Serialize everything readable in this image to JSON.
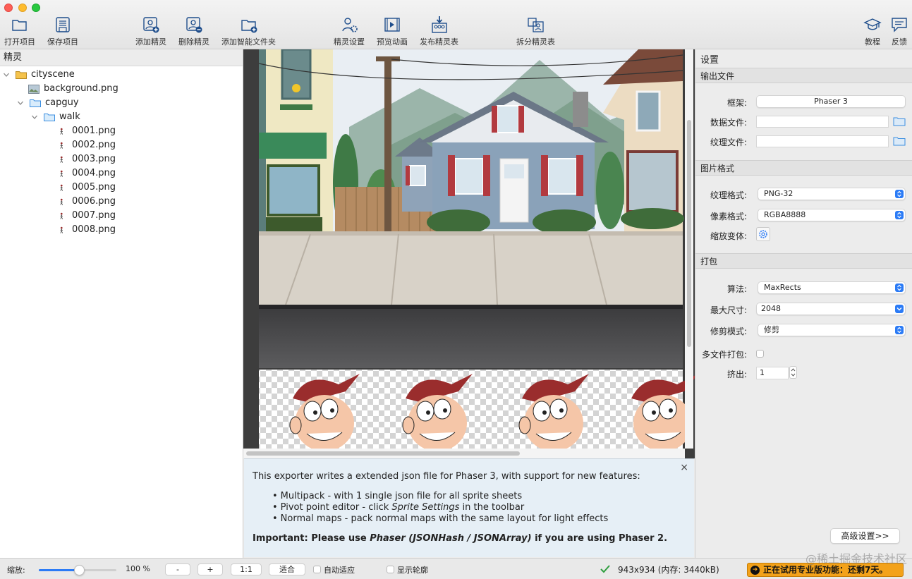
{
  "toolbar": {
    "open_project": "打开项目",
    "save_project": "保存项目",
    "add_sprite": "添加精灵",
    "remove_sprite": "删除精灵",
    "add_smart_folder": "添加智能文件夹",
    "sprite_settings": "精灵设置",
    "preview_animation": "预览动画",
    "publish_sprite_sheet": "发布精灵表",
    "split_sprite_sheet": "拆分精灵表",
    "tutorial": "教程",
    "feedback": "反馈"
  },
  "sprites_panel": {
    "title": "精灵",
    "tree": {
      "root": "cityscene",
      "background": "background.png",
      "capguy": "capguy",
      "walk": "walk",
      "frames": [
        "0001.png",
        "0002.png",
        "0003.png",
        "0004.png",
        "0005.png",
        "0006.png",
        "0007.png",
        "0008.png"
      ]
    }
  },
  "info_pane": {
    "intro": "This exporter writes a extended json file for Phaser 3, with support for new features:",
    "bullet1": "Multipack - with 1 single json file for all sprite sheets",
    "bullet2_pre": "Pivot point editor - click ",
    "bullet2_em": "Sprite Settings",
    "bullet2_post": " in the toolbar",
    "bullet3": "Normal maps - pack normal maps with the same layout for light effects",
    "important_pre": "Important: Please use ",
    "important_em": "Phaser (JSONHash / JSONArray)",
    "important_post": " if you are using Phaser 2.",
    "close": "×"
  },
  "settings": {
    "title": "设置",
    "output_section": "输出文件",
    "framework_label": "框架:",
    "framework_value": "Phaser 3",
    "data_file_label": "数据文件:",
    "data_file_value": "",
    "texture_file_label": "纹理文件:",
    "texture_file_value": "",
    "image_section": "图片格式",
    "texture_format_label": "纹理格式:",
    "texture_format_value": "PNG-32",
    "pixel_format_label": "像素格式:",
    "pixel_format_value": "RGBA8888",
    "scale_variants_label": "缩放变体:",
    "packing_section": "打包",
    "algorithm_label": "算法:",
    "algorithm_value": "MaxRects",
    "max_size_label": "最大尺寸:",
    "max_size_value": "2048",
    "trim_mode_label": "修剪模式:",
    "trim_mode_value": "修剪",
    "multipack_label": "多文件打包:",
    "extrude_label": "挤出:",
    "extrude_value": "1",
    "advanced_button": "高级设置>>"
  },
  "status_bar": {
    "zoom_label": "缩放:",
    "zoom_value": "100 %",
    "zoom_fraction": 0.52,
    "zoom_out": "-",
    "zoom_in": "+",
    "one_to_one": "1:1",
    "fit": "适合",
    "auto_fit": "自动适应",
    "show_outline": "显示轮廓",
    "size_info": "943x934 (内存: 3440kB)",
    "trial": "正在试用专业版功能：还剩7天。"
  },
  "watermark": "@稀土掘金技术社区",
  "colors": {
    "accent": "#2b7bf6",
    "trial_badge": "#f3a21a",
    "info_bg": "#e6eff6"
  }
}
